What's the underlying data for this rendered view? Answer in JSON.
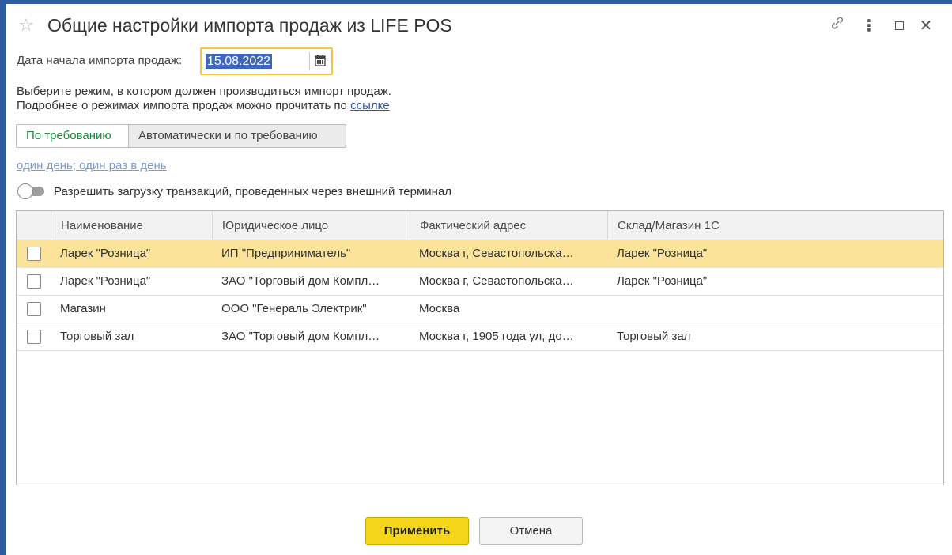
{
  "window": {
    "title": "Общие настройки импорта продаж из LIFE POS"
  },
  "icons": {
    "favorite": "star-icon",
    "link": "link-icon",
    "more": "more-vertical-icon",
    "maximize": "maximize-icon",
    "close": "close-icon",
    "calendar": "calendar-icon"
  },
  "date": {
    "label": "Дата начала импорта продаж:",
    "value": "15.08.2022"
  },
  "hint": {
    "line1": "Выберите режим, в котором должен производиться импорт продаж.",
    "line2": "Подробнее о режимах импорта продаж можно прочитать по",
    "link": "ссылке"
  },
  "mode": {
    "options": [
      "По требованию",
      "Автоматически и по требованию"
    ],
    "selected": "По требованию"
  },
  "schedule_link": "один день; один раз в день",
  "terminal_toggle": {
    "label": "Разрешить загрузку транзакций, проведенных через внешний терминал",
    "enabled": false
  },
  "table": {
    "columns": [
      "Наименование",
      "Юридическое лицо",
      "Фактический адрес",
      "Склад/Магазин 1С"
    ],
    "rows": [
      {
        "checked": false,
        "selected": true,
        "cells": [
          "Ларек \"Розница\"",
          "ИП \"Предприниматель\"",
          "Москва г, Севастопольска…",
          "Ларек \"Розница\""
        ]
      },
      {
        "checked": false,
        "selected": false,
        "cells": [
          "Ларек \"Розница\"",
          "ЗАО \"Торговый дом Компл…",
          "Москва г, Севастопольска…",
          "Ларек \"Розница\""
        ]
      },
      {
        "checked": false,
        "selected": false,
        "cells": [
          "Магазин",
          "ООО \"Генераль Электрик\"",
          "Москва",
          ""
        ]
      },
      {
        "checked": false,
        "selected": false,
        "cells": [
          "Торговый зал",
          "ЗАО \"Торговый дом Компл…",
          "Москва г, 1905 года ул, до…",
          "Торговый зал"
        ]
      }
    ]
  },
  "buttons": {
    "apply": "Применить",
    "cancel": "Отмена"
  },
  "colors": {
    "accent": "#f5d51a",
    "selected_row": "#fbe49a",
    "active_segment": "#1c8a3b",
    "link": "#2a5cb8",
    "frame": "#2d5aa0"
  }
}
